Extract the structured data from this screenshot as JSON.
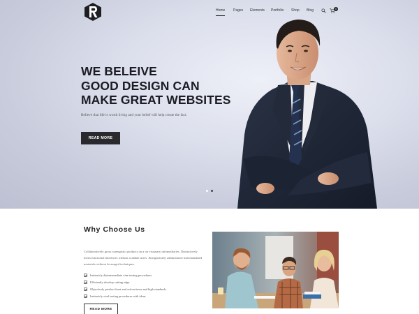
{
  "header": {
    "logo_icon": "r-logo-icon",
    "nav": [
      {
        "label": "Home",
        "active": true
      },
      {
        "label": "Pages",
        "active": false
      },
      {
        "label": "Elements",
        "active": false
      },
      {
        "label": "Portfolio",
        "active": false
      },
      {
        "label": "Shop",
        "active": false
      },
      {
        "label": "Blog",
        "active": false
      }
    ],
    "search_icon": "search-icon",
    "cart_icon": "cart-icon",
    "cart_count": "0"
  },
  "hero": {
    "title_lines": [
      "WE BELEIVE",
      "GOOD DESIGN CAN",
      "MAKE GREAT WEBSITES"
    ],
    "subtitle": "Believe that life is worth living and your belief will help create the fact.",
    "button_label": "READ MORE",
    "slides": 2,
    "active_slide": 2
  },
  "why": {
    "title": "Why Choose Us",
    "intro": "Collaboratively gross synergistic products on a on visionary infomediaries. Distinctively mesh functional interfaces without scalable users. Energistically administrate intermandated materials without leveraged techniques.",
    "features": [
      "Intrinsicly disintermediate vine testing procedures.",
      "Efficiently develop cutting edge.",
      "Objectively product front end action items and high standards.",
      "Intrinsicly viral testing procedures with ideas."
    ],
    "button_label": "READ MORE"
  },
  "colors": {
    "dark": "#2a2a2e",
    "hero_bg": "#d4d7e5",
    "suit": "#1e2738"
  }
}
